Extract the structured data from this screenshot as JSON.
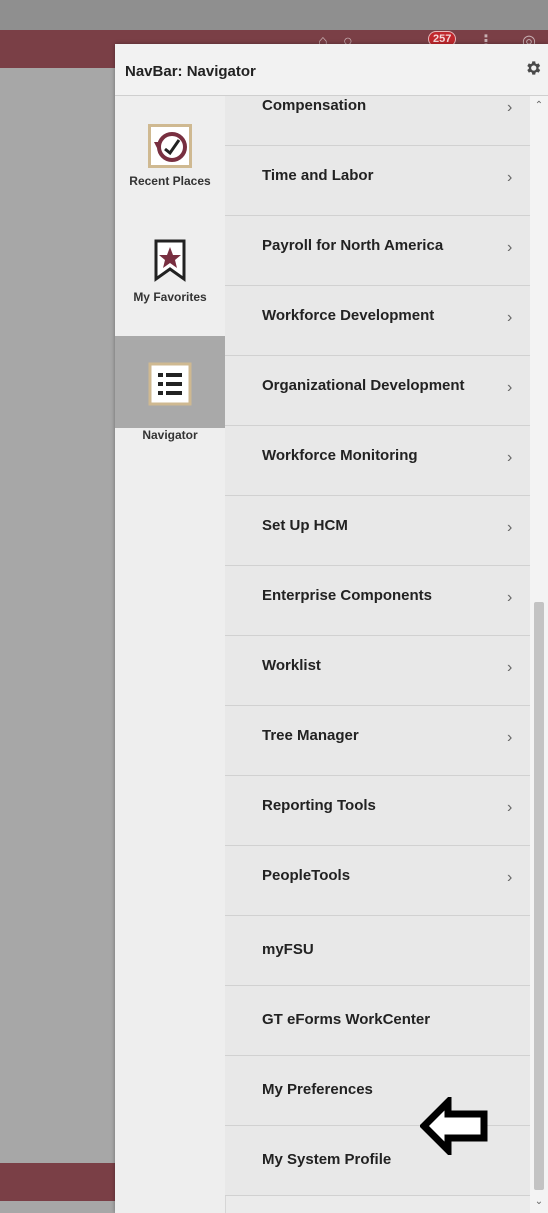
{
  "header": {
    "notification_count": "257"
  },
  "panel": {
    "title": "NavBar: Navigator",
    "settings_icon": "gear-icon"
  },
  "tabs": [
    {
      "label": "Recent Places",
      "icon": "recent-places-icon",
      "active": false
    },
    {
      "label": "My Favorites",
      "icon": "favorites-icon",
      "active": false
    },
    {
      "label": "Navigator",
      "icon": "navigator-icon",
      "active": true
    }
  ],
  "menu_items": [
    {
      "label": "Compensation",
      "has_submenu": true
    },
    {
      "label": "Time and Labor",
      "has_submenu": true
    },
    {
      "label": "Payroll for North America",
      "has_submenu": true
    },
    {
      "label": "Workforce Development",
      "has_submenu": true
    },
    {
      "label": "Organizational Development",
      "has_submenu": true
    },
    {
      "label": "Workforce Monitoring",
      "has_submenu": true
    },
    {
      "label": "Set Up HCM",
      "has_submenu": true
    },
    {
      "label": "Enterprise Components",
      "has_submenu": true
    },
    {
      "label": "Worklist",
      "has_submenu": true
    },
    {
      "label": "Tree Manager",
      "has_submenu": true
    },
    {
      "label": "Reporting Tools",
      "has_submenu": true
    },
    {
      "label": "PeopleTools",
      "has_submenu": true
    },
    {
      "label": "myFSU",
      "has_submenu": false
    },
    {
      "label": "GT eForms WorkCenter",
      "has_submenu": false
    },
    {
      "label": "My Preferences",
      "has_submenu": false
    },
    {
      "label": "My System Profile",
      "has_submenu": false
    }
  ],
  "colors": {
    "brand": "#7a3f46",
    "accent_icon": "#782f40",
    "icon_frame": "#cfb991",
    "active_tab": "#a9a9a9"
  }
}
